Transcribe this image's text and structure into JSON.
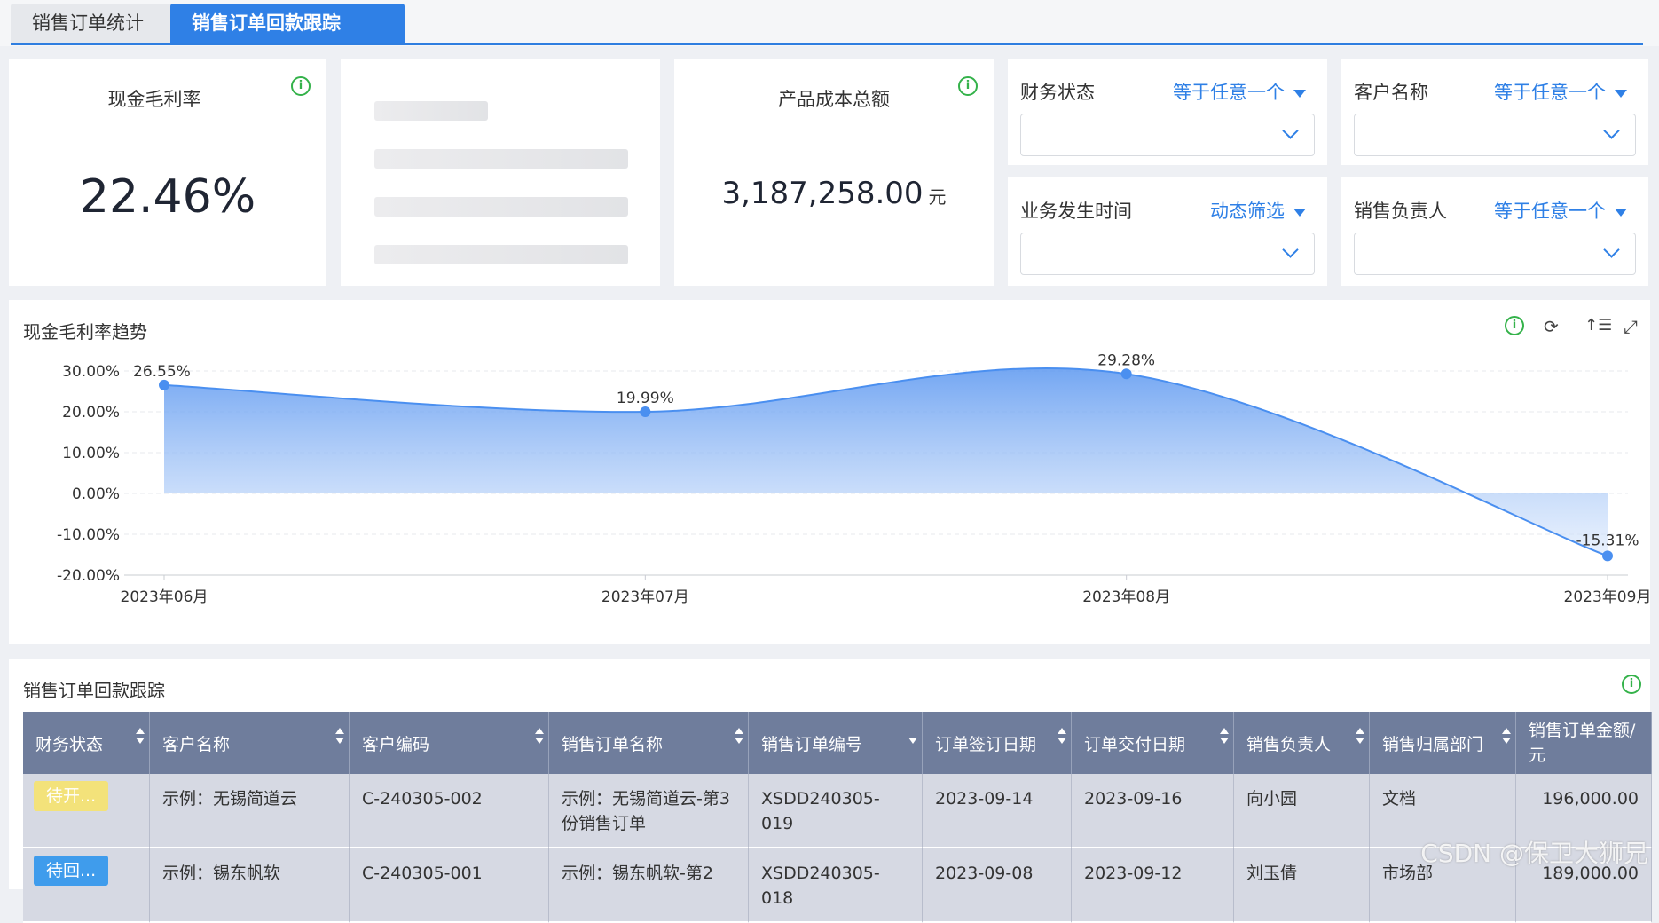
{
  "tabs": [
    {
      "label": "销售订单统计",
      "active": false
    },
    {
      "label": "销售订单回款跟踪",
      "active": true
    }
  ],
  "metrics": {
    "cash_margin": {
      "title": "现金毛利率",
      "value": "22.46%"
    },
    "product_cost": {
      "title": "产品成本总额",
      "value": "3,187,258.00",
      "unit": "元"
    }
  },
  "filters": [
    {
      "label": "财务状态",
      "mode": "等于任意一个"
    },
    {
      "label": "客户名称",
      "mode": "等于任意一个"
    },
    {
      "label": "业务发生时间",
      "mode": "动态筛选"
    },
    {
      "label": "销售负责人",
      "mode": "等于任意一个"
    }
  ],
  "chart_data": {
    "type": "area",
    "title": "现金毛利率趋势",
    "categories": [
      "2023年06月",
      "2023年07月",
      "2023年08月",
      "2023年09月"
    ],
    "values": [
      26.55,
      19.99,
      29.28,
      -15.31
    ],
    "value_labels": [
      "26.55%",
      "19.99%",
      "29.28%",
      "-15.31%"
    ],
    "y_ticks": [
      "30.00%",
      "20.00%",
      "10.00%",
      "0.00%",
      "-10.00%",
      "-20.00%"
    ],
    "ylim": [
      -20,
      30
    ],
    "grid": true,
    "color": "#4a8ff0"
  },
  "table": {
    "title": "销售订单回款跟踪",
    "columns": [
      "财务状态",
      "客户名称",
      "客户编码",
      "销售订单名称",
      "销售订单编号",
      "订单签订日期",
      "订单交付日期",
      "销售负责人",
      "销售归属部门",
      "销售订单金额/元"
    ],
    "rows": [
      {
        "status": "待开...",
        "status_color": "#f3e27a",
        "customer": "示例：无锡简道云",
        "code": "C-240305-002",
        "order_name": "示例：无锡简道云-第3份销售订单",
        "order_no": "XSDD240305-019",
        "sign_date": "2023-09-14",
        "deliver_date": "2023-09-16",
        "owner": "向小园",
        "dept": "文档",
        "amount": "196,000.00"
      },
      {
        "status": "待回...",
        "status_color": "#3f9cec",
        "customer": "示例：锡东帆软",
        "code": "C-240305-001",
        "order_name": "示例：锡东帆软-第2",
        "order_no": "XSDD240305-018",
        "sign_date": "2023-09-08",
        "deliver_date": "2023-09-12",
        "owner": "刘玉倩",
        "dept": "市场部",
        "amount": "189,000.00"
      }
    ]
  },
  "watermark": "CSDN @保卫大狮兄"
}
